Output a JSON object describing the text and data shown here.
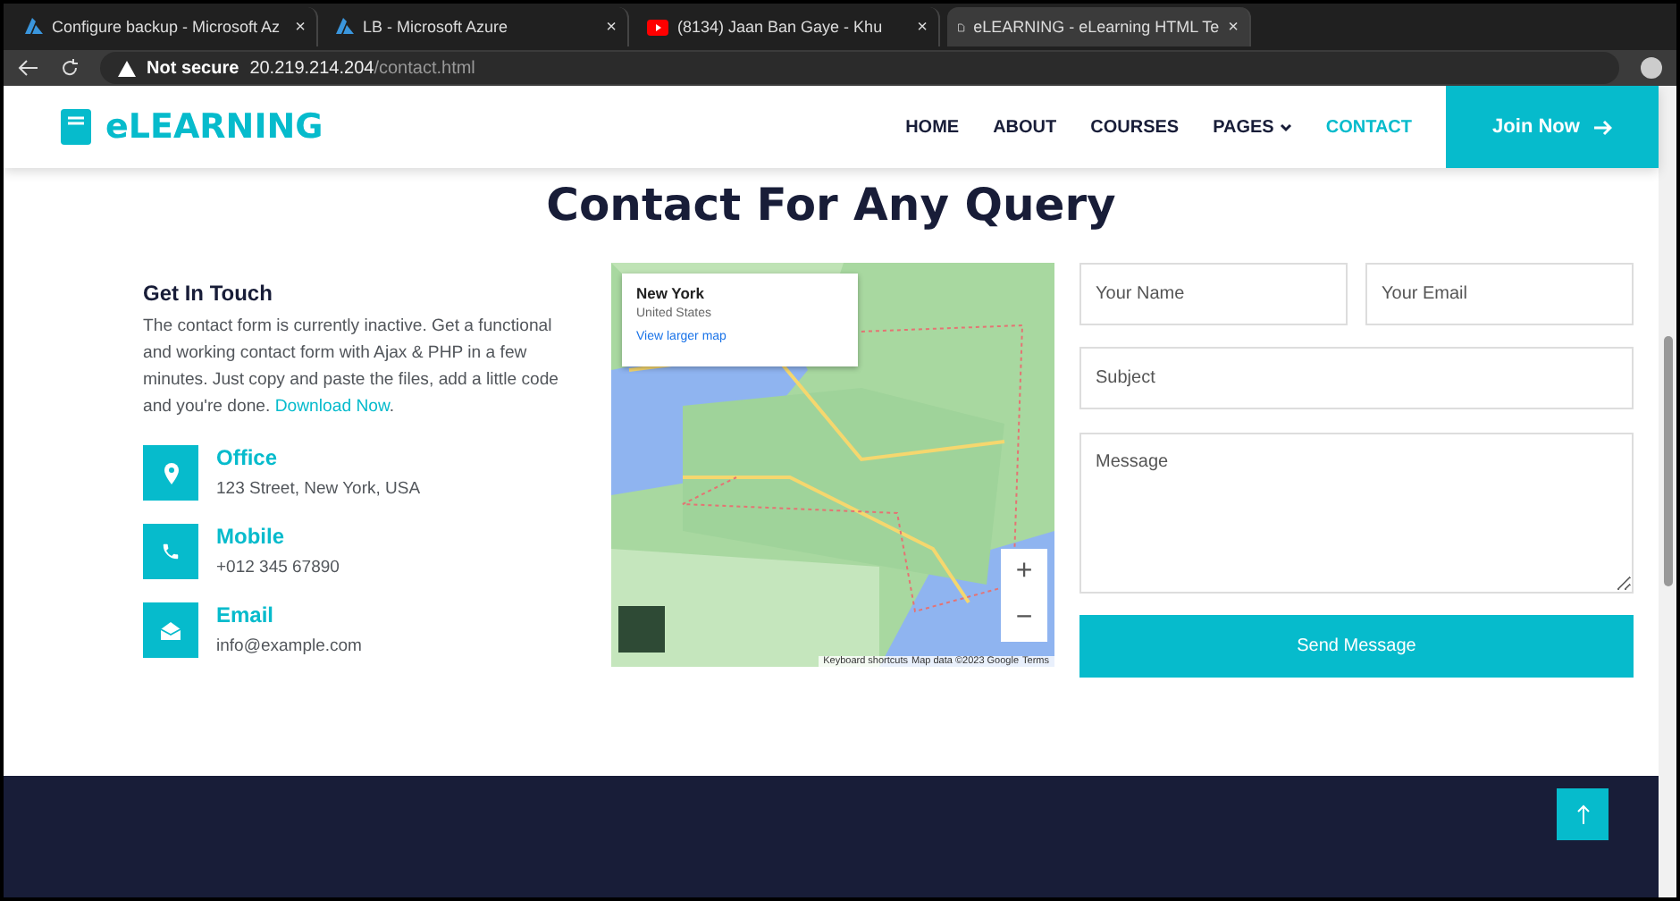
{
  "browser": {
    "tabs": [
      {
        "title": "Configure backup - Microsoft Az",
        "kind": "azure",
        "close": "×",
        "selected": false
      },
      {
        "title": "LB - Microsoft Azure",
        "kind": "azure",
        "close": "×",
        "selected": false
      },
      {
        "title": "(8134) Jaan Ban Gaye - Khu",
        "kind": "youtube",
        "close": "×",
        "selected": false
      },
      {
        "title": "eLEARNING - eLearning HTML Te",
        "kind": "page",
        "close": "×",
        "selected": true
      }
    ],
    "security": "Not secure",
    "host": "20.219.214.204",
    "path": "/contact.html"
  },
  "navbar": {
    "brand": "eLEARNING",
    "links": [
      {
        "label": "HOME",
        "selected": false,
        "dropdown": false
      },
      {
        "label": "ABOUT",
        "selected": false,
        "dropdown": false
      },
      {
        "label": "COURSES",
        "selected": false,
        "dropdown": false
      },
      {
        "label": "PAGES",
        "selected": false,
        "dropdown": true
      },
      {
        "label": "CONTACT",
        "selected": true,
        "dropdown": false
      }
    ],
    "cta": "Join Now"
  },
  "heading": "Contact For Any Query",
  "info": {
    "title": "Get In Touch",
    "text": "The contact form is currently inactive. Get a functional and working contact form with Ajax & PHP in a few minutes. Just copy and paste the files, add a little code and you're done.",
    "link": "Download Now",
    "after": ".",
    "items": [
      {
        "kind": "location",
        "label": "Office",
        "value": "123 Street, New York, USA"
      },
      {
        "kind": "phone",
        "label": "Mobile",
        "value": "+012 345 67890"
      },
      {
        "kind": "email",
        "label": "Email",
        "value": "info@example.com"
      }
    ]
  },
  "map": {
    "place": "New York",
    "region": "United States",
    "link": "View larger map",
    "zoom_in": "+",
    "zoom_out": "−",
    "attribution": [
      "Keyboard shortcuts",
      "Map data ©2023 Google",
      "Terms"
    ]
  },
  "form": {
    "name": {
      "placeholder": "Your Name"
    },
    "email": {
      "placeholder": "Your Email"
    },
    "subject": {
      "placeholder": "Subject"
    },
    "message": {
      "placeholder": "Message"
    },
    "submit": "Send Message"
  }
}
